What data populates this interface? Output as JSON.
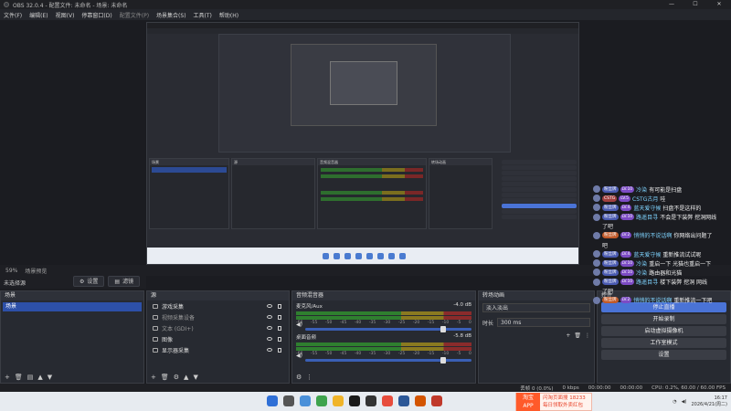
{
  "window": {
    "title": "OBS 32.0.4 - 配置文件: 未命名 - 场景: 未命名",
    "min": "—",
    "max": "☐",
    "close": "✕"
  },
  "menu": [
    "文件(F)",
    "编辑(E)",
    "视图(V)",
    "停靠窗口(D)",
    "配置文件(P)",
    "场景集合(S)",
    "工具(T)",
    "帮助(H)"
  ],
  "scene_bar": {
    "zoom": "59%",
    "label": "场景预览"
  },
  "source_bar": {
    "label": "未选择源",
    "properties": "设置",
    "filters": "滤镜"
  },
  "scenes": {
    "title": "场景",
    "items": [
      "场景"
    ]
  },
  "sources": {
    "title": "源",
    "items": [
      {
        "label": "游戏采集",
        "icon": "gamepad-icon"
      },
      {
        "label": "视频采集设备",
        "icon": "camera-icon"
      },
      {
        "label": "文本 (GDI+)",
        "icon": "text-icon"
      },
      {
        "label": "图像",
        "icon": "image-icon"
      },
      {
        "label": "显示器采集",
        "icon": "monitor-icon"
      }
    ]
  },
  "mixer": {
    "title": "音频混音器",
    "channels": [
      {
        "name": "麦克风/Aux",
        "db": "-4.0 dB"
      },
      {
        "name": "桌面音频",
        "db": "-5.8 dB"
      }
    ],
    "ticks": [
      "-60",
      "-55",
      "-50",
      "-45",
      "-40",
      "-35",
      "-30",
      "-25",
      "-20",
      "-15",
      "-10",
      "-5",
      "0"
    ]
  },
  "transitions": {
    "title": "转场动画",
    "type": "淡入淡出",
    "duration_label": "时长",
    "duration": "300 ms"
  },
  "controls": {
    "title": "控件",
    "buttons": [
      "停止直播",
      "开始录制",
      "启动虚拟摄像机",
      "工作室模式",
      "设置"
    ]
  },
  "chat": [
    {
      "badge": "粉丝牌",
      "lvl": "LV.10",
      "user": "冷染",
      "text": "有可能是扫盘"
    },
    {
      "badge": "CSTG",
      "lvl": "LV.5",
      "user": "CSTG古月",
      "text": "哇"
    },
    {
      "badge": "粉丝牌",
      "lvl": "LV.4",
      "user": "蓝天爱守候",
      "text": "扫盘不是这样的"
    },
    {
      "badge": "粉丝牌",
      "lvl": "LV.10",
      "user": "路遥目寻",
      "text": "不会是下装弊 挖洞网线"
    },
    {
      "badge": "",
      "lvl": "",
      "user": "",
      "text": "了吧"
    },
    {
      "badge": "粉丝牌",
      "lvl": "LV.2",
      "user": "悄悄的不说话啊",
      "text": "你网络出问题了"
    },
    {
      "badge": "",
      "lvl": "",
      "user": "",
      "text": "吧"
    },
    {
      "badge": "粉丝牌",
      "lvl": "LV.4",
      "user": "蓝天爱守候",
      "text": "重新推流试试呢"
    },
    {
      "badge": "粉丝牌",
      "lvl": "LV.10",
      "user": "冷染",
      "text": "重启一下 光猫也重启一下"
    },
    {
      "badge": "粉丝牌",
      "lvl": "LV.10",
      "user": "冷染",
      "text": "路由器和光猫"
    },
    {
      "badge": "粉丝牌",
      "lvl": "LV.10",
      "user": "路遥目寻",
      "text": "楼下装弊 挖洞 网线"
    },
    {
      "badge": "",
      "lvl": "",
      "user": "",
      "text": "了吧"
    },
    {
      "badge": "粉丝牌",
      "lvl": "LV.2",
      "user": "悄悄的不说话啊",
      "text": "重新推流一下吧"
    }
  ],
  "status": {
    "dropped": "丢帧 0 (0.0%)",
    "kbps": "0 kbps",
    "live": "00:00:00",
    "rec": "00:00:00",
    "cpu": "CPU: 0.2%, 60.00 / 60.00 FPS"
  },
  "ad": {
    "brand_l1": "淘宝",
    "brand_l2": "APP",
    "line1": "闪淘页面搜 18233",
    "line2": "每日领取外卖红包"
  },
  "tray": {
    "time": "16:17",
    "date": "2026/4/21(周二)"
  },
  "colors": {
    "accent": "#4a73d6",
    "selection": "#2d50a8"
  }
}
